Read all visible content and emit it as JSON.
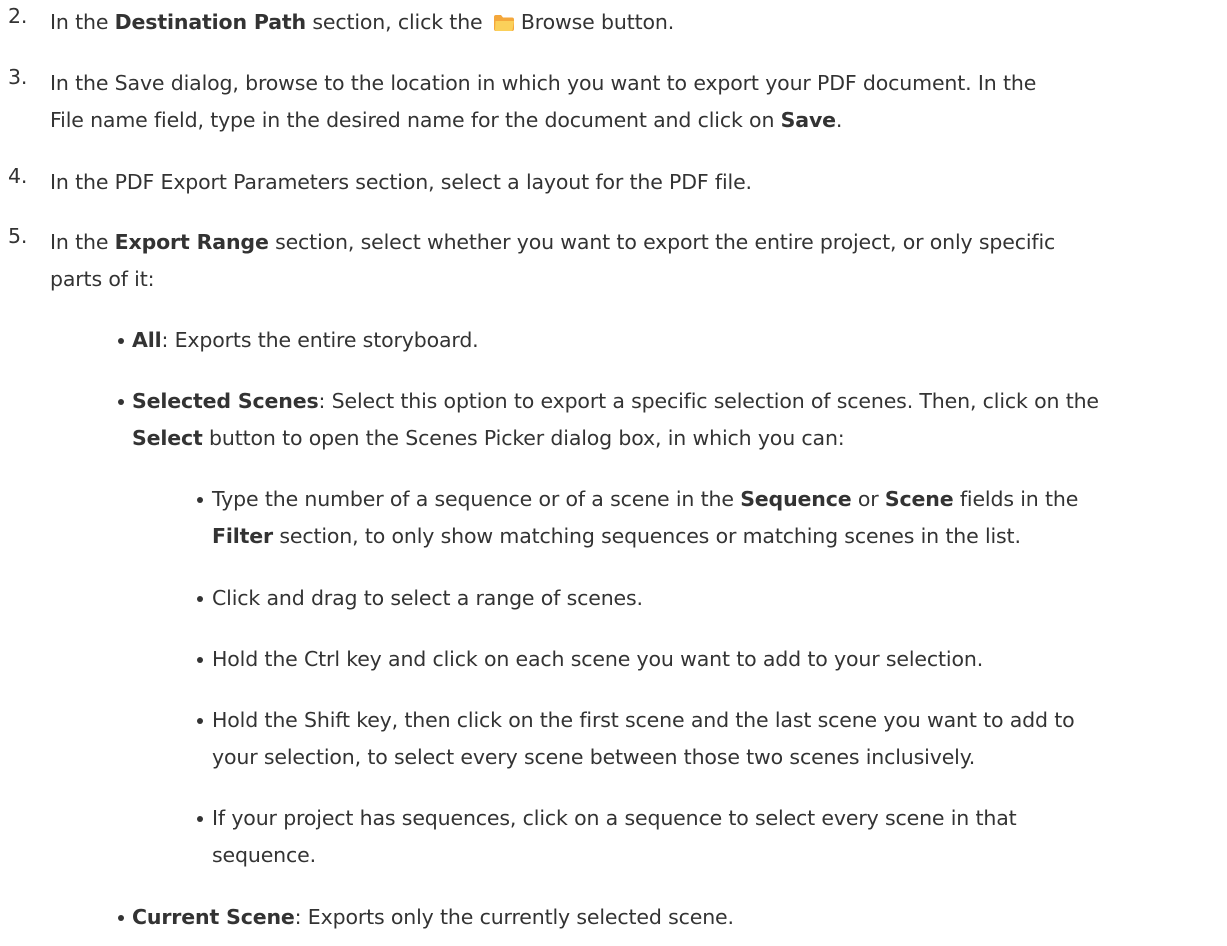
{
  "steps": [
    {
      "num": "2.",
      "lines": [
        [
          "In the ",
          "Destination Path",
          " section, click the ",
          "Browse button."
        ]
      ]
    },
    {
      "num": "3.",
      "lines": [
        [
          "In the Save dialog, browse to the location in which you want to export your PDF document. In the"
        ],
        [
          "File name field, type in the desired name for the document and click on ",
          "Save",
          "."
        ]
      ]
    },
    {
      "num": "4.",
      "lines": [
        [
          "In the PDF Export Parameters section, select a layout for the PDF file."
        ]
      ]
    },
    {
      "num": "5.",
      "lines": [
        [
          "In the ",
          "Export Range",
          " section, select whether you want to export the entire project, or only specific"
        ],
        [
          "parts of it:"
        ]
      ]
    }
  ],
  "range_options": [
    {
      "lines": [
        [
          "All",
          ": Exports the entire storyboard."
        ]
      ]
    },
    {
      "lines": [
        [
          "Selected Scenes",
          ": Select this option to export a specific selection of scenes. Then, click on the"
        ],
        [
          "Select",
          " button to open the Scenes Picker dialog box, in which you can:"
        ]
      ]
    },
    {
      "lines": [
        [
          "Current Scene",
          ": Exports only the currently selected scene."
        ]
      ]
    }
  ],
  "picker_tips": [
    {
      "lines": [
        [
          "Type the number of a sequence or of a scene in the ",
          "Sequence",
          " or ",
          "Scene",
          " fields in the"
        ],
        [
          "Filter",
          " section, to only show matching sequences or matching scenes in the list."
        ]
      ]
    },
    {
      "lines": [
        [
          "Click and drag to select a range of scenes."
        ]
      ]
    },
    {
      "lines": [
        [
          "Hold the Ctrl key and click on each scene you want to add to your selection."
        ]
      ]
    },
    {
      "lines": [
        [
          "Hold the Shift key, then click on the first scene and the last scene you want to add to"
        ],
        [
          "your selection, to select every scene between those two scenes inclusively."
        ]
      ]
    },
    {
      "lines": [
        [
          "If your project has sequences, click on a sequence to select every scene in that"
        ],
        [
          "sequence."
        ]
      ]
    }
  ],
  "icons": {
    "browse": "folder-icon"
  },
  "colors": {
    "text": "#333333",
    "folder": "#f4a73b"
  }
}
